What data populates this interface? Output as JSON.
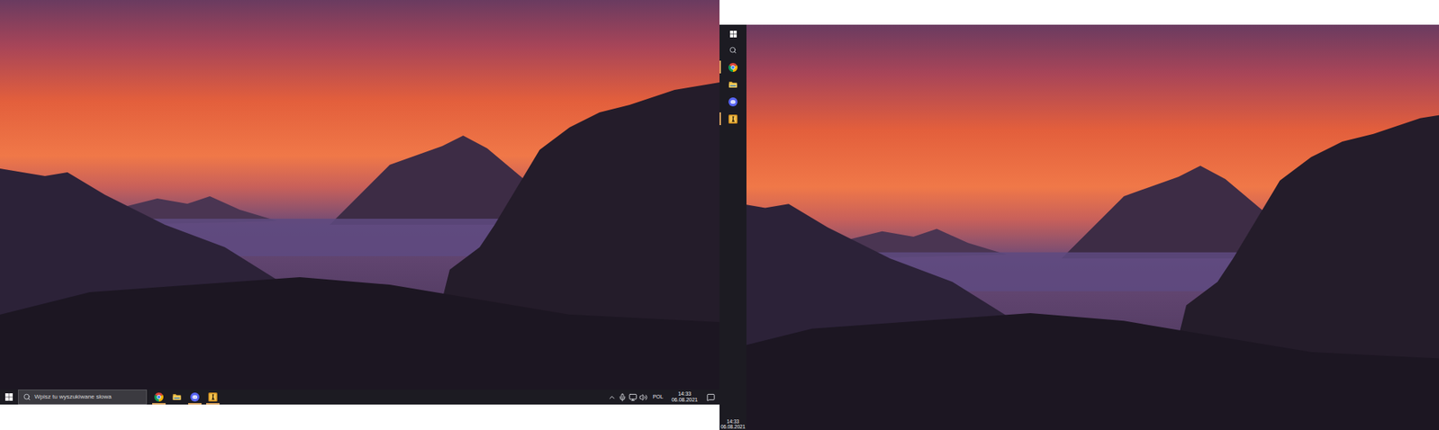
{
  "left_monitor": {
    "taskbar": {
      "search": {
        "placeholder": "Wpisz tu wyszukiwane słowa"
      },
      "apps": [
        {
          "kind": "chrome",
          "running": true
        },
        {
          "kind": "explorer",
          "running": false
        },
        {
          "kind": "discord",
          "running": true
        },
        {
          "kind": "game",
          "running": true
        }
      ],
      "tray": [
        {
          "kind": "chevron"
        },
        {
          "kind": "mic"
        },
        {
          "kind": "network"
        },
        {
          "kind": "volume"
        }
      ],
      "language": "POL",
      "time": "14:33",
      "date": "06.08.2021"
    }
  },
  "right_monitor": {
    "taskbar": {
      "apps": [
        {
          "kind": "chrome",
          "running": true
        },
        {
          "kind": "explorer",
          "running": false
        },
        {
          "kind": "discord",
          "running": false
        },
        {
          "kind": "game",
          "running": true
        }
      ],
      "time": "14:33",
      "date": "06.08.2021"
    }
  }
}
